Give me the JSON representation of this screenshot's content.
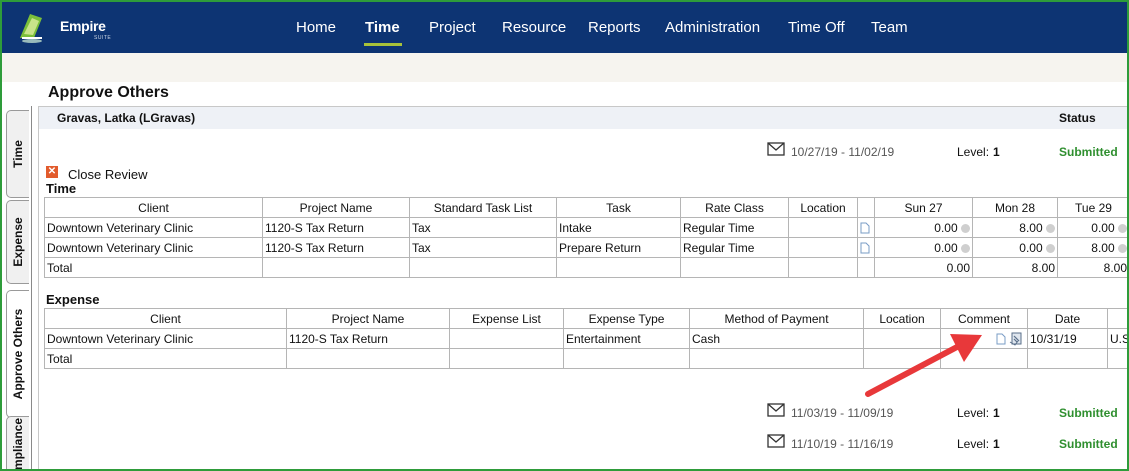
{
  "app": {
    "brand": "Empire",
    "brand_sub": "SUITE"
  },
  "nav": [
    "Home",
    "Time",
    "Project",
    "Resource",
    "Reports",
    "Administration",
    "Time Off",
    "Team"
  ],
  "nav_active": "Time",
  "side_tabs": [
    "Time",
    "Expense",
    "Approve Others",
    "Compliance"
  ],
  "page_title": "Approve Others",
  "employee": {
    "name": "Gravas, Latka (LGravas)",
    "status_header": "Status"
  },
  "periods": [
    {
      "range": "10/27/19 - 11/02/19",
      "level_label": "Level:",
      "level": "1",
      "status": "Submitted"
    },
    {
      "range": "11/03/19 - 11/09/19",
      "level_label": "Level:",
      "level": "1",
      "status": "Submitted"
    },
    {
      "range": "11/10/19 - 11/16/19",
      "level_label": "Level:",
      "level": "1",
      "status": "Submitted"
    }
  ],
  "close_review": "Close Review",
  "time": {
    "title": "Time",
    "headers": [
      "Client",
      "Project Name",
      "Standard Task List",
      "Task",
      "Rate Class",
      "Location",
      "",
      "Sun 27",
      "Mon 28",
      "Tue 29"
    ],
    "rows": [
      {
        "client": "Downtown Veterinary Clinic",
        "project": "1120-S Tax Return",
        "std_task": "Tax",
        "task": "Intake",
        "rate": "Regular Time",
        "location": "",
        "sun": "0.00",
        "mon": "8.00",
        "tue": "0.00"
      },
      {
        "client": "Downtown Veterinary Clinic",
        "project": "1120-S Tax Return",
        "std_task": "Tax",
        "task": "Prepare Return",
        "rate": "Regular Time",
        "location": "",
        "sun": "0.00",
        "mon": "0.00",
        "tue": "8.00"
      }
    ],
    "total": {
      "label": "Total",
      "sun": "0.00",
      "mon": "8.00",
      "tue": "8.00"
    }
  },
  "expense": {
    "title": "Expense",
    "headers": [
      "Client",
      "Project Name",
      "Expense List",
      "Expense Type",
      "Method of Payment",
      "Location",
      "Comment",
      "Date",
      ""
    ],
    "rows": [
      {
        "client": "Downtown Veterinary Clinic",
        "project": "1120-S Tax Return",
        "list": "",
        "type": "Entertainment",
        "payment": "Cash",
        "location": "",
        "date": "10/31/19",
        "currency": "U.S"
      }
    ],
    "total": {
      "label": "Total"
    }
  },
  "colors": {
    "nav_bg": "#0d3473",
    "accent": "#a8c23a",
    "submitted": "#2f8f2f",
    "arrow": "#e8383a",
    "frame": "#2e9c3a"
  }
}
